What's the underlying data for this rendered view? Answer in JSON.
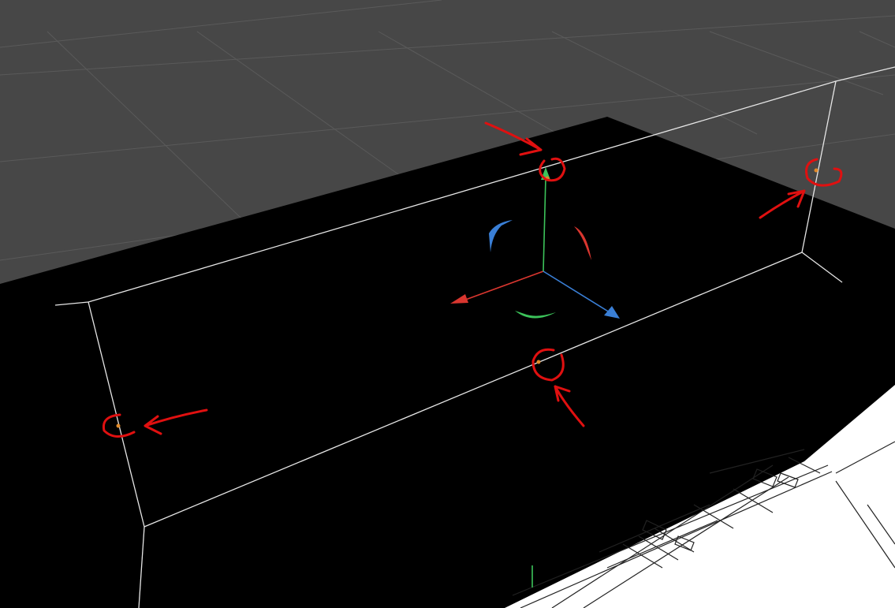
{
  "scene": {
    "colors": {
      "viewport_bg": "#474747",
      "grid_line": "#5a5a5a",
      "top_band": "#383838",
      "plane": "#000000",
      "box_edge": "#e6e6e6",
      "vertex_handle": "#e08a2a",
      "axis_x": "#d9362f",
      "axis_y": "#3cc35a",
      "axis_z": "#3a7fd6",
      "annotation": "#e01010",
      "floorplan_paper": "#ffffff",
      "floorplan_ink": "#222222"
    },
    "annotation_count": 4,
    "gizmo": {
      "axes": [
        {
          "name": "x",
          "color_key": "axis_x"
        },
        {
          "name": "y",
          "color_key": "axis_y"
        },
        {
          "name": "z",
          "color_key": "axis_z"
        }
      ],
      "rotation_handles": [
        {
          "plane": "xy",
          "color_key": "axis_z"
        },
        {
          "plane": "yz",
          "color_key": "axis_x"
        },
        {
          "plane": "xz",
          "color_key": "axis_y"
        }
      ]
    },
    "vertex_handles": [
      "top-center",
      "top-right",
      "left",
      "bottom-center"
    ]
  }
}
